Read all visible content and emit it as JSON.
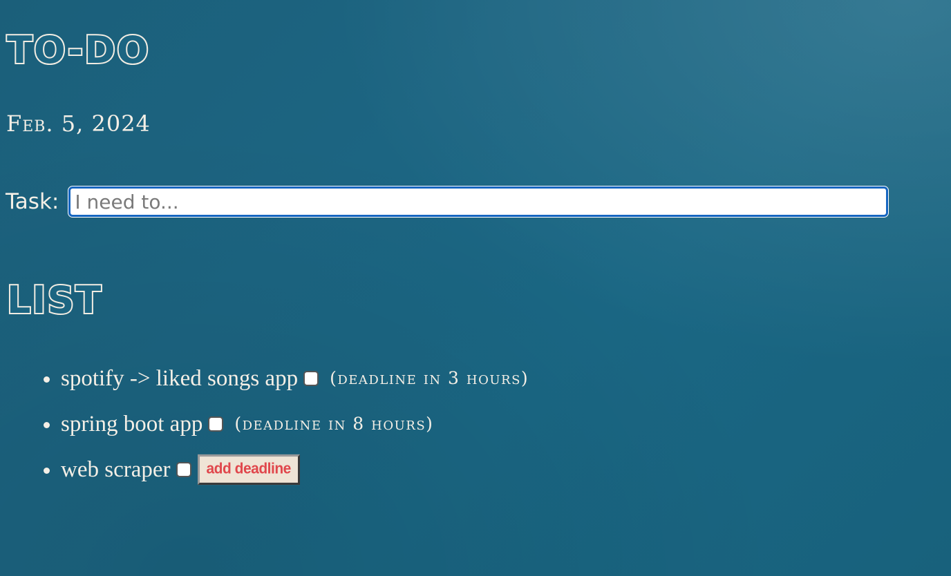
{
  "header": {
    "title": "TO-DO",
    "date": "Feb. 5, 2024"
  },
  "task_form": {
    "label": "Task:",
    "placeholder": "I need to..."
  },
  "list": {
    "heading": "LIST",
    "items": [
      {
        "text": "spotify -> liked songs app",
        "checked": false,
        "deadline": "(deadline in 3 hours)"
      },
      {
        "text": "spring boot app",
        "checked": false,
        "deadline": "(deadline in 8 hours)"
      },
      {
        "text": "web scraper",
        "checked": false,
        "button": "add deadline"
      }
    ]
  },
  "colors": {
    "background": "#1c6582",
    "text": "#f4efe6",
    "input_border": "#1565c0",
    "button_bg": "#efe4d6",
    "button_text": "#e0474c"
  }
}
